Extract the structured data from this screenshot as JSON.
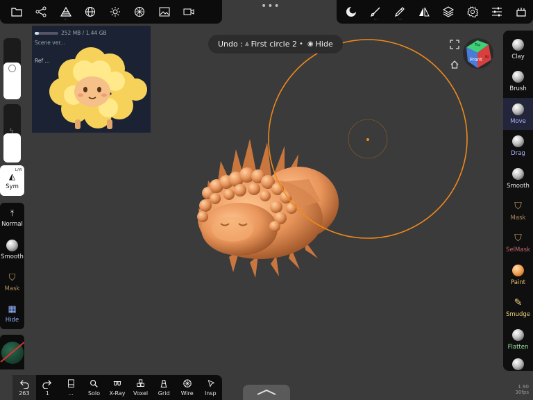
{
  "top_left_tools": [
    {
      "name": "folder-icon",
      "dots": ""
    },
    {
      "name": "share-icon",
      "dots": ""
    },
    {
      "name": "scene-icon",
      "dots": "..."
    },
    {
      "name": "mesh-icon",
      "dots": ""
    },
    {
      "name": "light-icon",
      "dots": ""
    },
    {
      "name": "material-icon",
      "dots": ""
    },
    {
      "name": "image-icon",
      "dots": ""
    },
    {
      "name": "camera-icon",
      "dots": ""
    }
  ],
  "top_right_tools": [
    {
      "name": "stroke-icon",
      "dots": ""
    },
    {
      "name": "brush-icon",
      "dots": "..."
    },
    {
      "name": "pen-icon",
      "dots": "..."
    },
    {
      "name": "symmetry-icon",
      "dots": ""
    },
    {
      "name": "layers-icon",
      "dots": ""
    },
    {
      "name": "settings-icon",
      "dots": ""
    },
    {
      "name": "sliders-icon",
      "dots": ""
    },
    {
      "name": "gallery-icon",
      "dots": ""
    }
  ],
  "more_menu": "•••",
  "undo": {
    "prefix": "Undo :",
    "action": "First circle 2",
    "separator": "•",
    "hide_label": "Hide"
  },
  "reference": {
    "memory": "252 MB / 1.44 GB",
    "memory_fraction": 0.17,
    "scene_label": "Scene ver...",
    "line3": "Ref ..."
  },
  "left_tools": {
    "radius_value": 0.6,
    "intensity_value": 0.5,
    "sym": {
      "label": "Sym",
      "badge": "L/W"
    },
    "normal": {
      "label": "Normal"
    },
    "smooth": {
      "label": "Smooth"
    },
    "mask": {
      "label": "Mask"
    },
    "hide": {
      "label": "Hide"
    }
  },
  "right_tools": [
    {
      "label": "Clay",
      "active": false
    },
    {
      "label": "Brush",
      "active": false
    },
    {
      "label": "Move",
      "active": true
    },
    {
      "label": "Drag",
      "active": false
    },
    {
      "label": "Smooth",
      "active": false
    },
    {
      "label": "Mask",
      "active": false
    },
    {
      "label": "SelMask",
      "active": false
    },
    {
      "label": "Paint",
      "active": false
    },
    {
      "label": "Smudge",
      "active": false
    },
    {
      "label": "Flatten",
      "active": false
    }
  ],
  "bottom_tools": [
    {
      "name": "undo-icon",
      "label": "263",
      "active": true
    },
    {
      "name": "redo-icon",
      "label": "1",
      "active": false
    },
    {
      "name": "doc-icon",
      "label": "...",
      "active": false
    },
    {
      "name": "solo-icon",
      "label": "Solo",
      "active": false
    },
    {
      "name": "xray-icon",
      "label": "X-Ray",
      "active": false
    },
    {
      "name": "voxel-icon",
      "label": "Voxel",
      "active": false
    },
    {
      "name": "grid-icon",
      "label": "Grid",
      "active": false
    },
    {
      "name": "wire-icon",
      "label": "Wire",
      "active": false
    },
    {
      "name": "inspect-icon",
      "label": "Insp",
      "active": false
    }
  ],
  "gizmo": {
    "front": "Front",
    "top": "Top",
    "right": "Ri"
  },
  "fps": {
    "line1": "1.90",
    "line2": "30fps"
  },
  "colors": {
    "accent_orange": "#f08a1a",
    "model": "#e89a5e",
    "active_blue": "#aab4ff"
  }
}
